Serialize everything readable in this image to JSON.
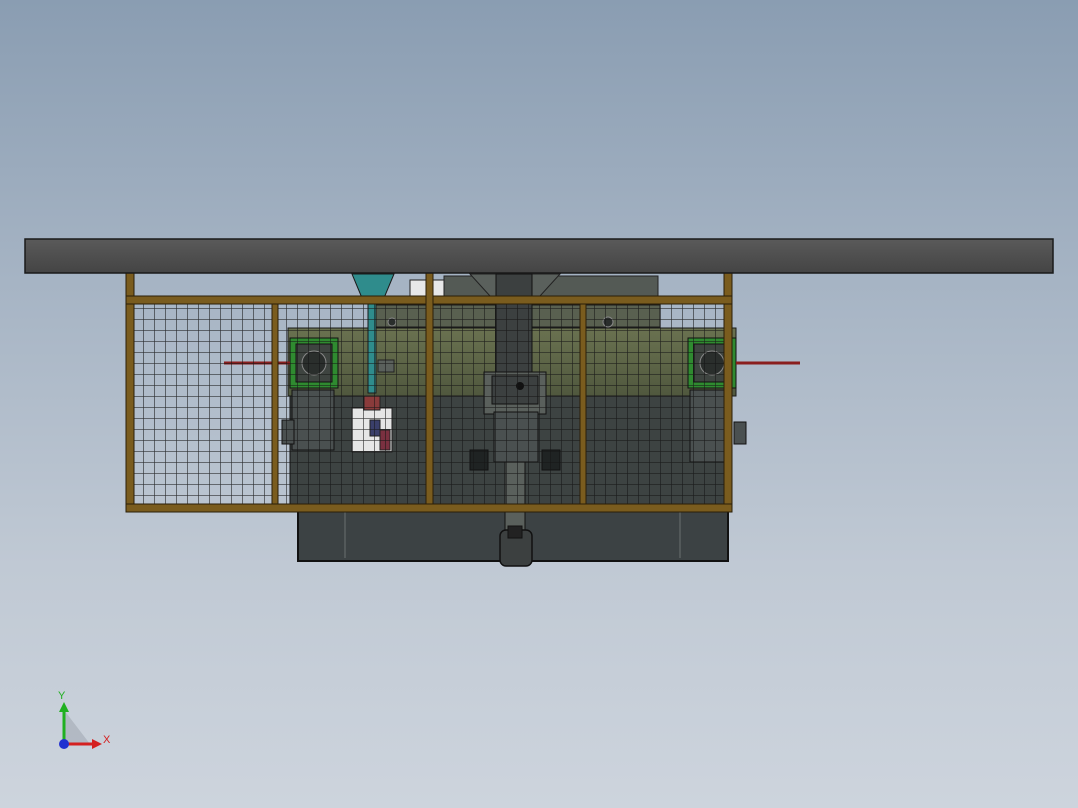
{
  "viewport": {
    "background_top": "#8a9db2",
    "background_bottom": "#cdd4dd"
  },
  "model": {
    "colors": {
      "roof": "#4d4d4d",
      "frame": "#7a5c1e",
      "frame_highlight": "#a07a30",
      "mesh": "#1a1a1a",
      "machine_body": "#5c6448",
      "machine_dark": "#3c4240",
      "motor_green": "#2e8a2e",
      "hopper_teal": "#2f8c8c",
      "shaft_red": "#8a1e1e",
      "base": "#3a3f40"
    }
  },
  "triad": {
    "x_label": "X",
    "y_label": "Y",
    "icon": "coordinate-triad-icon",
    "x_color": "#d42020",
    "y_color": "#20b020",
    "z_color": "#2030d0"
  }
}
